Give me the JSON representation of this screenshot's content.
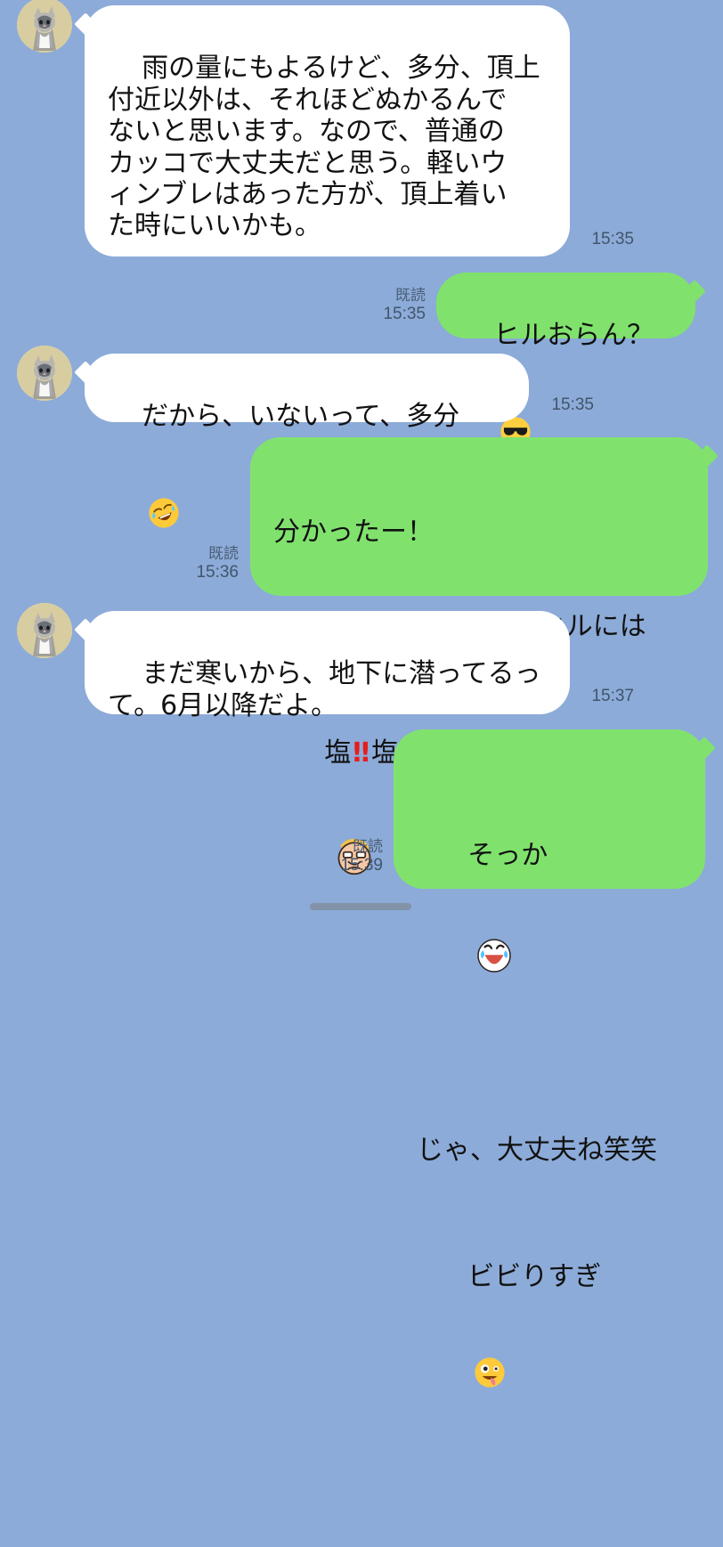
{
  "messages": [
    {
      "text": "雨の量にもよるけど、多分、頂上\n付近以外は、それほどぬかるんで\nないと思います。なので、普通の\nカッコで大丈夫だと思う。軽いウ\nィンブレはあった方が、頂上着い\nた時にいいかも。",
      "time": "15:35"
    },
    {
      "text": "ヒルおらん？",
      "read": "既読",
      "time": "15:35"
    },
    {
      "text": "だから、いないって、多分",
      "time": "15:35"
    },
    {
      "line1": "分かったー！",
      "line2": "とりあえず色々調べてヒルには",
      "line3_prefix": "塩",
      "line3_mark": "‼",
      "line3_suffix": "塩もってく",
      "read": "既読",
      "time": "15:36"
    },
    {
      "text": "まだ寒いから、地下に潜ってるっ\nて。6月以降だよ。",
      "time": "15:37"
    },
    {
      "line1": "そっか",
      "line2": "じゃ、大丈夫ね笑笑",
      "line3": "ビビりすぎ",
      "read": "既読",
      "time": "15:39"
    }
  ],
  "icons": {
    "avatar": "cat-avatar-icon",
    "sunglasses": "sunglasses-emoji-icon",
    "rofl": "rolling-laughing-emoji-icon",
    "worried_face": "worried-face-sticker-icon",
    "laughing_crying": "laughing-crying-sticker-icon",
    "zany": "zany-face-emoji-icon"
  },
  "colors": {
    "background": "#8cabd8",
    "incoming_bubble": "#ffffff",
    "outgoing_bubble": "#80e26d",
    "timestamp": "#41556b"
  }
}
